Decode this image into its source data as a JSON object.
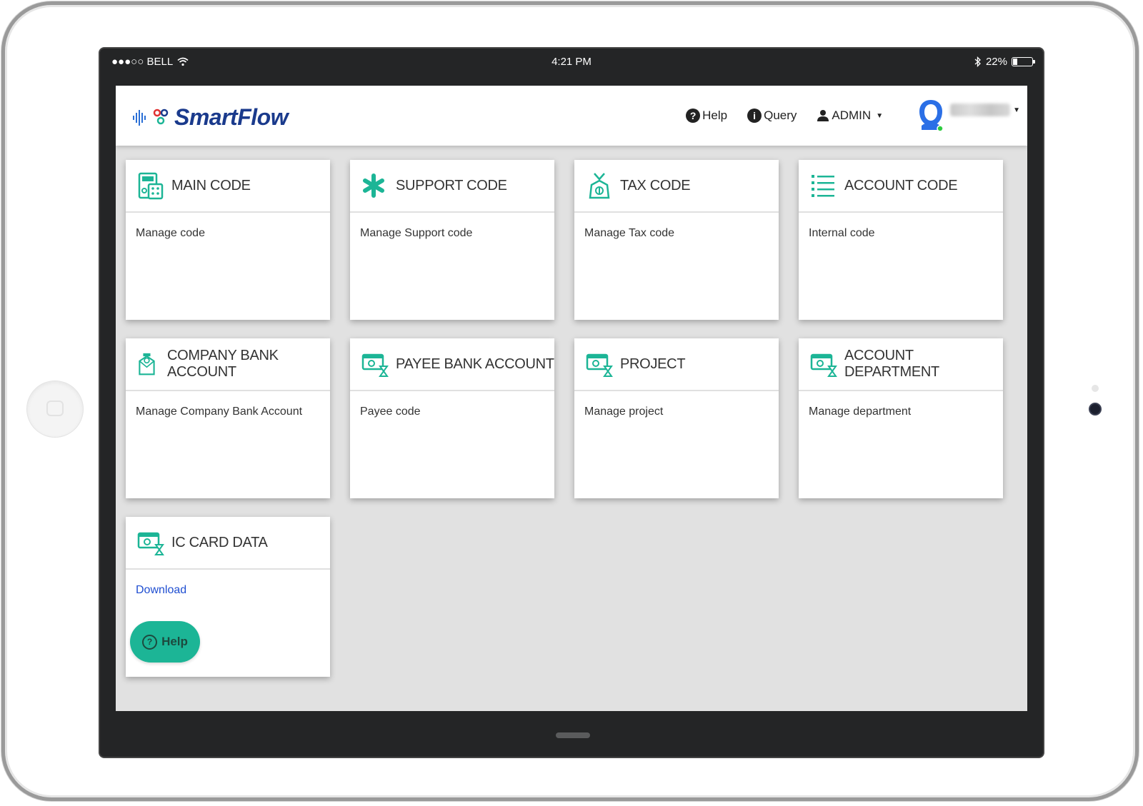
{
  "status_bar": {
    "carrier": "●●●○○ BELL",
    "time": "4:21 PM",
    "battery": "22%",
    "battery_level": 0.22
  },
  "app": {
    "logo_text": "SmartFlow",
    "nav": {
      "help": "Help",
      "query": "Query",
      "user_role": "ADMIN"
    }
  },
  "cards": [
    {
      "title": "MAIN CODE",
      "description": "Manage code",
      "icon": "calculator-icon"
    },
    {
      "title": "SUPPORT CODE",
      "description": "Manage Support code",
      "icon": "asterisk-icon"
    },
    {
      "title": "TAX CODE",
      "description": "Manage Tax code",
      "icon": "money-bag-icon"
    },
    {
      "title": "ACCOUNT CODE",
      "description": "Internal code",
      "icon": "list-icon"
    },
    {
      "title": "COMPANY BANK ACCOUNT",
      "description": "Manage Company Bank Account",
      "icon": "bank-envelope-icon"
    },
    {
      "title": "PAYEE BANK ACCOUNT",
      "description": "Payee code",
      "icon": "cash-hourglass-icon"
    },
    {
      "title": "PROJECT",
      "description": "Manage project",
      "icon": "cash-hourglass-icon"
    },
    {
      "title": "ACCOUNT DEPARTMENT",
      "description": "Manage department",
      "icon": "cash-hourglass-icon"
    },
    {
      "title": "IC CARD DATA",
      "description": "Download",
      "icon": "cash-hourglass-icon"
    }
  ],
  "help_button": {
    "label": "Help"
  },
  "colors": {
    "accent": "#1cb596",
    "brand": "#1a3a8c",
    "link": "#1f4ed1",
    "bezel": "#242526"
  }
}
